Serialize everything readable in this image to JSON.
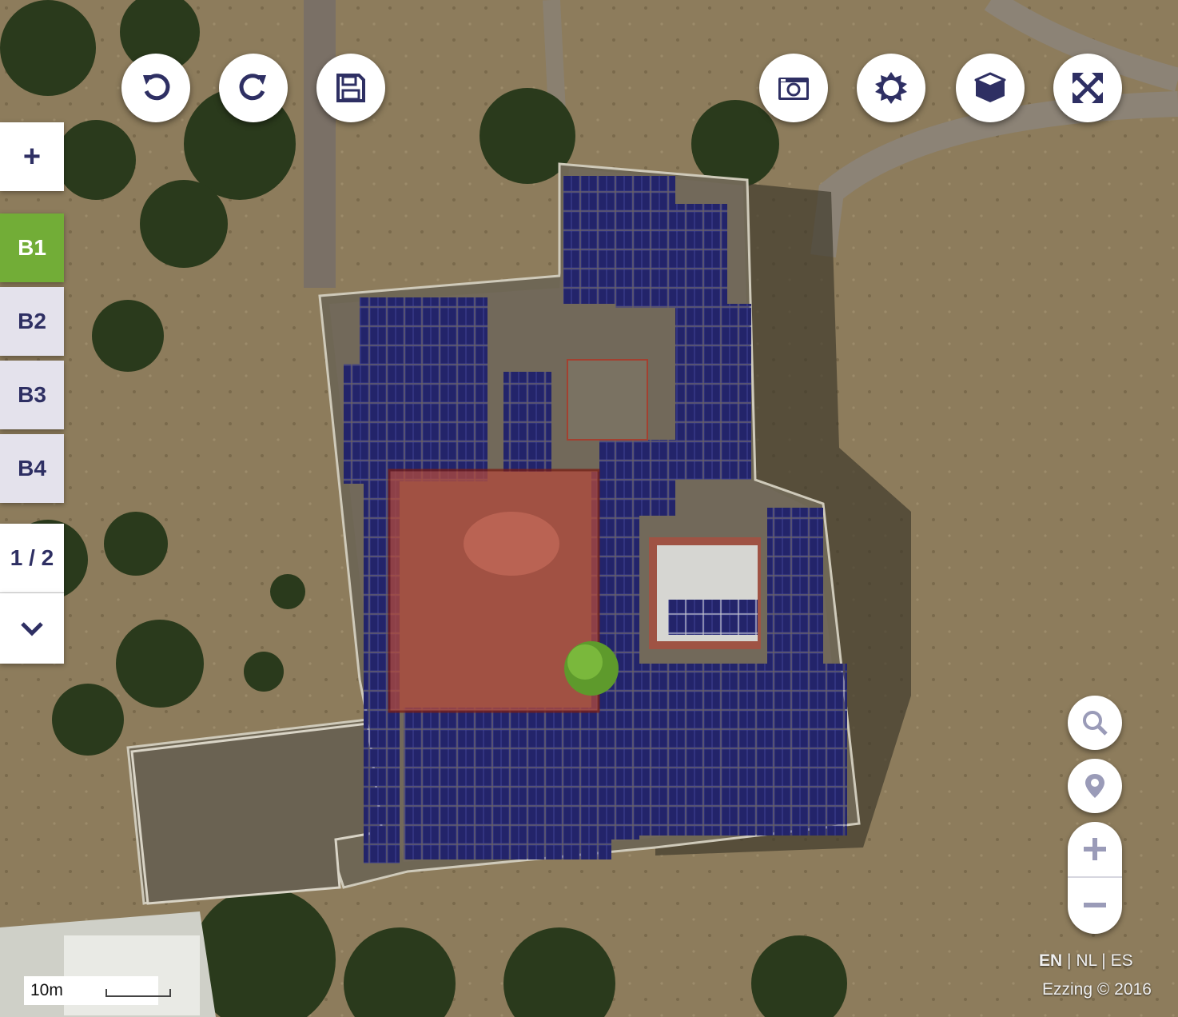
{
  "toolbar_left": [
    {
      "name": "undo-button",
      "icon": "undo-icon"
    },
    {
      "name": "redo-button",
      "icon": "redo-icon"
    },
    {
      "name": "save-button",
      "icon": "save-icon"
    }
  ],
  "toolbar_right": [
    {
      "name": "screenshot-button",
      "icon": "camera-icon"
    },
    {
      "name": "shading-button",
      "icon": "sun-icon"
    },
    {
      "name": "3d-view-button",
      "icon": "cube-icon"
    },
    {
      "name": "fullscreen-button",
      "icon": "expand-icon"
    }
  ],
  "sidebar": {
    "add_label": "+",
    "buildings": [
      {
        "label": "B1",
        "active": true
      },
      {
        "label": "B2",
        "active": false
      },
      {
        "label": "B3",
        "active": false
      },
      {
        "label": "B4",
        "active": false
      }
    ],
    "page_indicator": "1 / 2",
    "more_icon": "chevron-down-icon"
  },
  "map_controls": {
    "search_icon": "search-icon",
    "locate_icon": "location-pin-icon",
    "zoom_in_icon": "plus-icon",
    "zoom_out_icon": "minus-icon"
  },
  "language": {
    "options": [
      "EN",
      "NL",
      "ES"
    ],
    "selected": "EN",
    "separator": "|"
  },
  "copyright": "Ezzing © 2016",
  "scale": {
    "label": "10m"
  },
  "colors": {
    "brand_navy": "#2e2f63",
    "active_green": "#72ad37",
    "inactive_tab": "#e4e2ec",
    "solar_panel": "#23246a",
    "excluded_zone": "#b14a3c"
  }
}
